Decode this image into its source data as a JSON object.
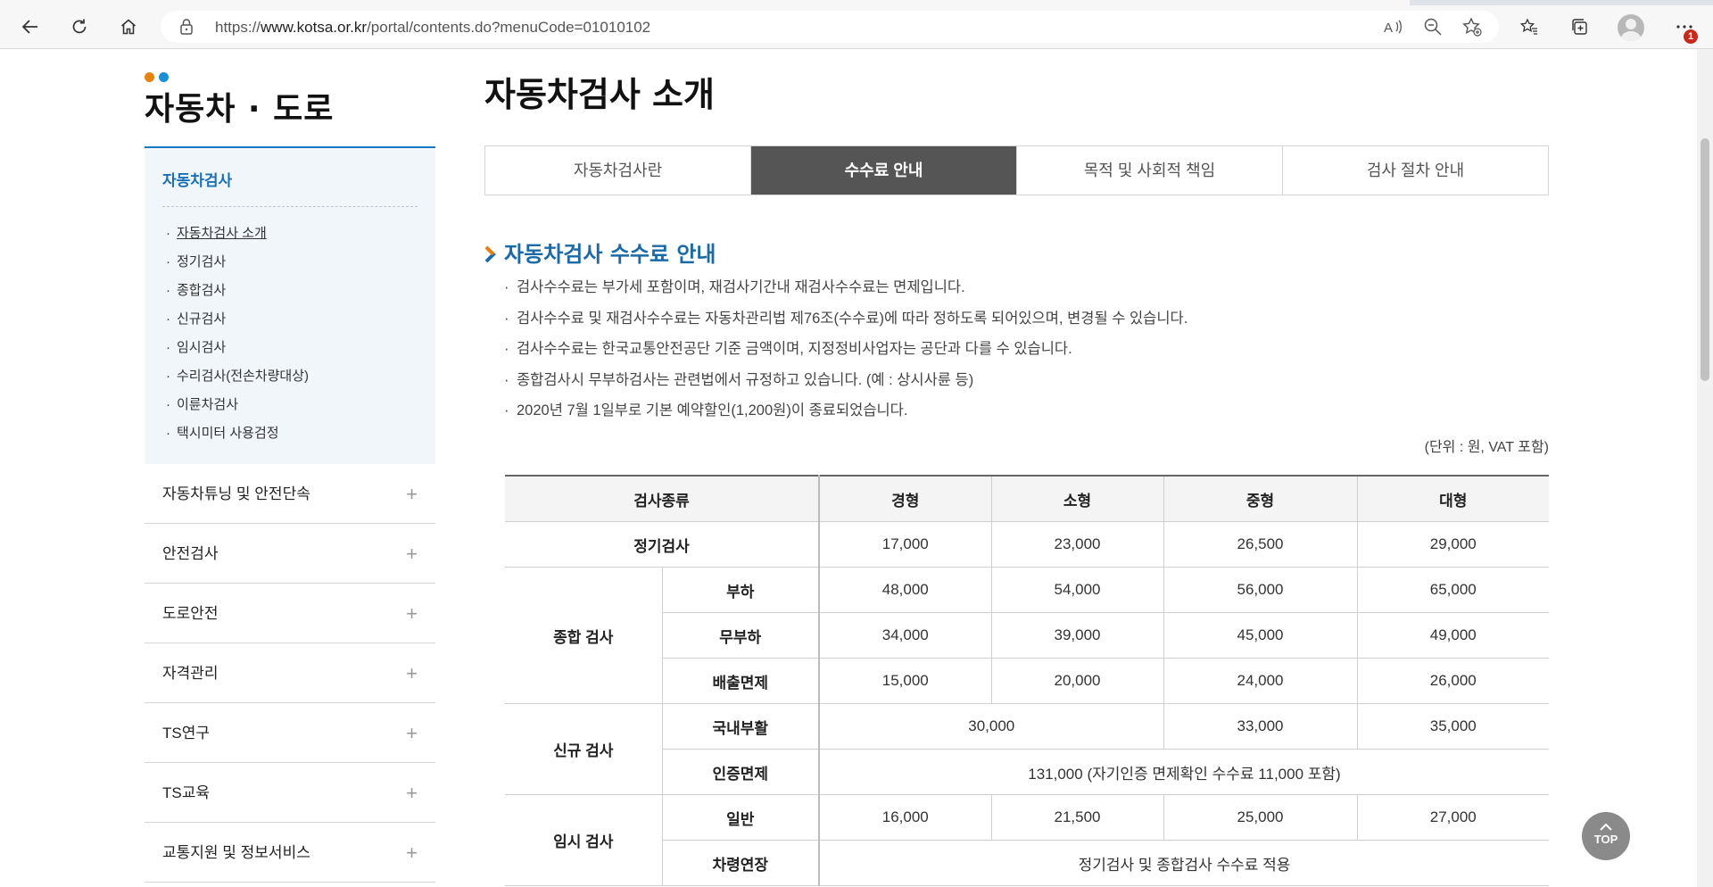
{
  "browser": {
    "url_prefix": "https://",
    "url_host": "www.kotsa.or.kr",
    "url_path": "/portal/contents.do?menuCode=01010102",
    "notification_count": "1"
  },
  "site": {
    "section_title": "자동차 · 도로",
    "dot_colors": [
      "#e8820e",
      "#1a8fd6"
    ]
  },
  "sidebar": {
    "active_heading": "자동차검사",
    "sub_items": [
      {
        "label": "자동차검사 소개",
        "current": true
      },
      {
        "label": "정기검사"
      },
      {
        "label": "종합검사"
      },
      {
        "label": "신규검사"
      },
      {
        "label": "임시검사"
      },
      {
        "label": "수리검사(전손차량대상)"
      },
      {
        "label": "이륜차검사"
      },
      {
        "label": "택시미터 사용검정"
      }
    ],
    "items": [
      {
        "label": "자동차튜닝 및 안전단속"
      },
      {
        "label": "안전검사"
      },
      {
        "label": "도로안전"
      },
      {
        "label": "자격관리"
      },
      {
        "label": "TS연구"
      },
      {
        "label": "TS교육"
      },
      {
        "label": "교통지원 및 정보서비스"
      }
    ],
    "expand_symbol": "+",
    "bullet": "·"
  },
  "main": {
    "title": "자동차검사 소개",
    "tabs": [
      {
        "label": "자동차검사란"
      },
      {
        "label": "수수료 안내",
        "active": true
      },
      {
        "label": "목적 및 사회적 책임"
      },
      {
        "label": "검사 절차 안내"
      }
    ],
    "section_title": "자동차검사 수수료 안내",
    "notes": [
      "검사수수료는 부가세 포함이며, 재검사기간내 재검사수수료는 면제입니다.",
      "검사수수료 및 재검사수수료는 자동차관리법 제76조(수수료)에 따라 정하도록 되어있으며, 변경될 수 있습니다.",
      "검사수수료는 한국교통안전공단 기준 금액이며, 지정정비사업자는 공단과 다를 수 있습니다.",
      "종합검사시 무부하검사는 관련법에서 규정하고 있습니다. (예 : 상시사륜 등)",
      "2020년 7월 1일부로 기본 예약할인(1,200원)이 종료되었습니다."
    ],
    "unit_note": "(단위 : 원, VAT 포함)",
    "table": {
      "headers": [
        "검사종류",
        "경형",
        "소형",
        "중형",
        "대형"
      ],
      "regular": {
        "label": "정기검사",
        "values": [
          "17,000",
          "23,000",
          "26,500",
          "29,000"
        ]
      },
      "comprehensive": {
        "label": "종합 검사",
        "rows": [
          {
            "label": "부하",
            "values": [
              "48,000",
              "54,000",
              "56,000",
              "65,000"
            ]
          },
          {
            "label": "무부하",
            "values": [
              "34,000",
              "39,000",
              "45,000",
              "49,000"
            ]
          },
          {
            "label": "배출면제",
            "values": [
              "15,000",
              "20,000",
              "24,000",
              "26,000"
            ]
          }
        ]
      },
      "new": {
        "label": "신규 검사",
        "domestic": {
          "label": "국내부활",
          "small": "30,000",
          "mid": "33,000",
          "large": "35,000"
        },
        "cert_exempt": {
          "label": "인증면제",
          "value": "131,000 (자기인증 면제확인 수수료 11,000 포함)"
        }
      },
      "temporary": {
        "label": "임시 검사",
        "general": {
          "label": "일반",
          "values": [
            "16,000",
            "21,500",
            "25,000",
            "27,000"
          ]
        },
        "extension": {
          "label": "차령연장",
          "value": "정기검사 및 종합검사 수수료 적용"
        }
      }
    }
  },
  "top_button": "TOP"
}
